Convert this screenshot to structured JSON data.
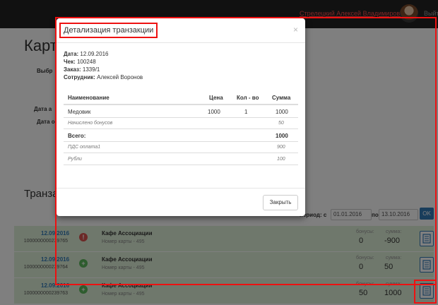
{
  "navbar": {
    "user_name": "Стрелецкий Алексей Владимирович",
    "logout_label": "Выйти"
  },
  "page": {
    "title": "Карт",
    "labels": {
      "select": "Выбр",
      "date_a": "Дата а",
      "date_o": "Дата о"
    },
    "section_title": "Транза"
  },
  "filter": {
    "period_label": "период: с",
    "from_value": "01.01.2016",
    "to_label": "по",
    "to_value": "13.10.2016",
    "ok_label": "OK"
  },
  "transactions": [
    {
      "date": "12.09.2016",
      "check": "1000000000239765",
      "type": "minus",
      "icon_glyph": "!",
      "place": "Кафе Ассоциации",
      "card": "Номер карты - 495",
      "bonus_label": "бонусы:",
      "bonus": "0",
      "sum_label": "сумма:",
      "sum": "-900"
    },
    {
      "date": "12.09.2016",
      "check": "1000000000239764",
      "type": "plus",
      "icon_glyph": "+",
      "place": "Кафе Ассоциации",
      "card": "Номер карты - 495",
      "bonus_label": "бонусы:",
      "bonus": "0",
      "sum_label": "сумма:",
      "sum": "50"
    },
    {
      "date": "12.09.2016",
      "check": "1000000000239763",
      "type": "plus",
      "icon_glyph": "+",
      "place": "Кафе Ассоциации",
      "card": "Номер карты - 495",
      "bonus_label": "бонусы:",
      "bonus": "50",
      "sum_label": "сумма:",
      "sum": "1000"
    }
  ],
  "modal": {
    "title": "Детализация транзакции",
    "close_x": "×",
    "info": {
      "date_label": "Дата:",
      "date_value": "12.09.2016",
      "check_label": "Чек:",
      "check_value": "100248",
      "order_label": "Заказ:",
      "order_value": "1339/1",
      "employee_label": "Сотрудник:",
      "employee_value": "Алексей Воронов"
    },
    "table": {
      "headers": {
        "name": "Наименование",
        "price": "Цена",
        "qty": "Кол - во",
        "sum": "Сумма"
      },
      "item": {
        "name": "Медовик",
        "price": "1000",
        "qty": "1",
        "sum": "1000"
      },
      "bonus_row": {
        "name": "Начислено бонусов",
        "sum": "50"
      },
      "total_row": {
        "name": "Всего:",
        "sum": "1000"
      },
      "pay_row": {
        "name": "ПДС оплата1",
        "sum": "900"
      },
      "rub_row": {
        "name": "Рубли",
        "sum": "100"
      }
    },
    "close_button": "Закрыть"
  },
  "colors": {
    "navbar": "#222222",
    "row_bg": "#dff0d8",
    "primary": "#337ab7",
    "highlight": "#ee1111"
  }
}
